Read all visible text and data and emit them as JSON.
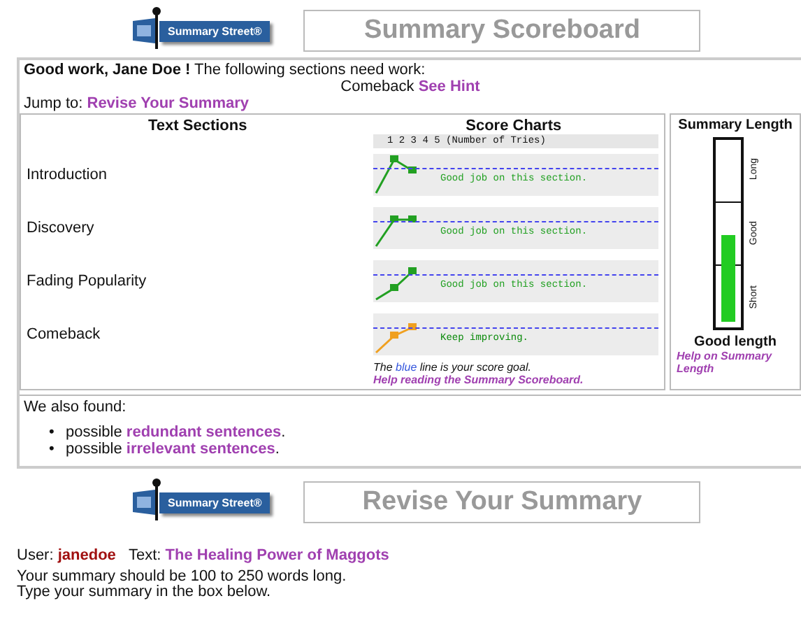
{
  "header": {
    "logo_text": "Summary Street®",
    "title": "Summary Scoreboard"
  },
  "feedback": {
    "greeting": "Good work, Jane Doe !",
    "message": "The following sections need work:",
    "section": "Comeback",
    "hint_link": "See Hint",
    "jump_label": "Jump to:",
    "jump_link": "Revise Your Summary"
  },
  "sections_table": {
    "column_1": "Text Sections",
    "column_2": "Score Charts",
    "axis_label": "1  2  3  4  5 (Number of Tries)",
    "sections": [
      {
        "name": "Introduction",
        "kind": "good",
        "message": "Good job on this section."
      },
      {
        "name": "Discovery",
        "kind": "good",
        "message": "Good job on this section."
      },
      {
        "name": "Fading Popularity",
        "kind": "good",
        "message": "Good job on this section."
      },
      {
        "name": "Comeback",
        "kind": "improving",
        "message": "Keep improving."
      }
    ],
    "legend_pre": "The",
    "legend_blue": "blue",
    "legend_post": "line is your score goal.",
    "help_link": "Help reading the Summary Scoreboard."
  },
  "length": {
    "title": "Summary Length",
    "labels": [
      "Long",
      "Good",
      "Short"
    ],
    "level": 0.46,
    "verdict": "Good length",
    "help_link": "Help on Summary Length"
  },
  "also_found": {
    "title": "We also found:",
    "items": [
      {
        "bullet": "•",
        "prefix": "possible",
        "link": "redundant sentences",
        "suffix": "."
      },
      {
        "bullet": "•",
        "prefix": "possible",
        "link": "irrelevant sentences",
        "suffix": "."
      }
    ]
  },
  "revise": {
    "logo_text": "Summary Street®",
    "title": "Revise Your Summary"
  },
  "user": {
    "user_label": "User:",
    "username": "janedoe",
    "text_label": "Text:",
    "text_title": "The Healing Power of Maggots"
  },
  "instructions": [
    "Your summary should be 100 to 250 words long.",
    "Type your summary in the box below."
  ]
}
